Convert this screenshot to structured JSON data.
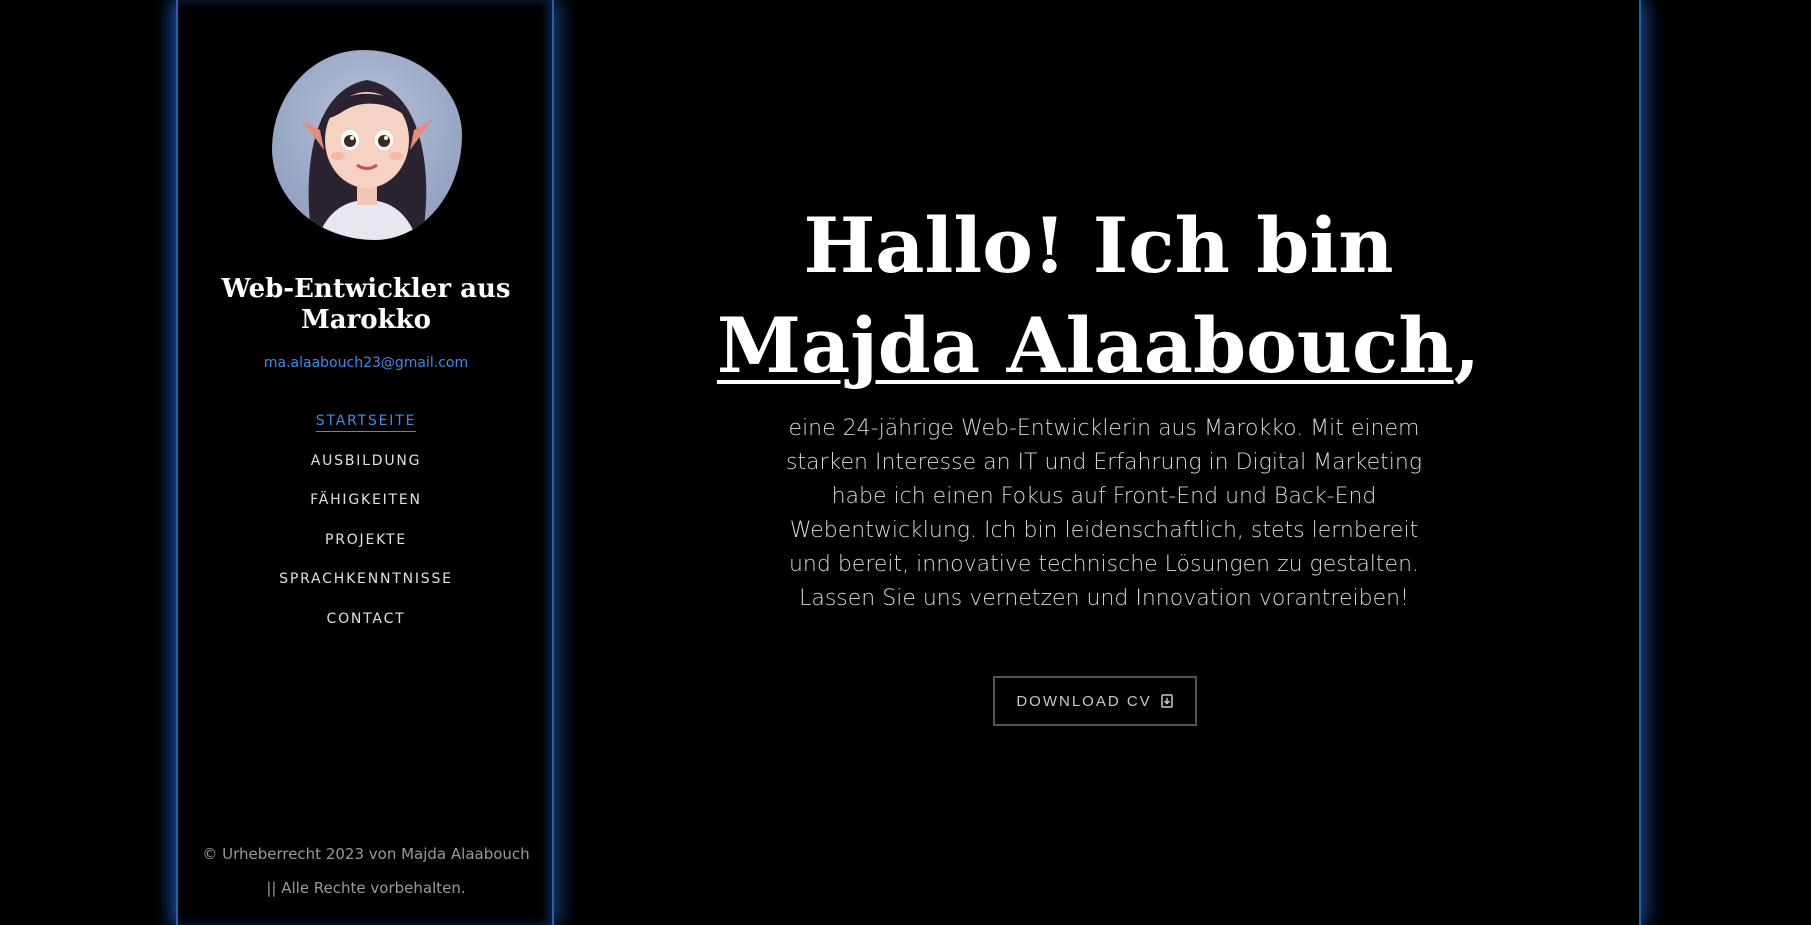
{
  "sidebar": {
    "title": "Web-Entwickler aus Marokko",
    "email": "ma.alaabouch23@gmail.com",
    "nav": [
      {
        "label": "STARTSEITE",
        "active": true
      },
      {
        "label": "AUSBILDUNG",
        "active": false
      },
      {
        "label": "FÄHIGKEITEN",
        "active": false
      },
      {
        "label": "PROJEKTE",
        "active": false
      },
      {
        "label": "SPRACHKENNTNISSE",
        "active": false
      },
      {
        "label": "CONTACT",
        "active": false
      }
    ],
    "copyright_line1": "© Urheberrecht 2023 von Majda Alaabouch",
    "copyright_line2": "|| Alle Rechte vorbehalten."
  },
  "main": {
    "greeting": "Hallo! Ich bin",
    "name": "Majda Alaabouch",
    "name_suffix": ",",
    "intro": "eine 24-jährige Web-Entwicklerin aus Marokko. Mit einem starken Interesse an IT und Erfahrung in Digital Marketing habe ich einen Fokus auf Front-End und Back-End Webentwicklung. Ich bin leidenschaftlich, stets lernbereit und bereit, innovative technische Lösungen zu gestalten. Lassen Sie uns vernetzen und Innovation vorantreiben!",
    "cv_button": "DOWNLOAD CV",
    "cv_icon": "download-file-icon"
  },
  "colors": {
    "background": "#000000",
    "accent": "#3b8bea",
    "glow": "#2a5fa8"
  }
}
